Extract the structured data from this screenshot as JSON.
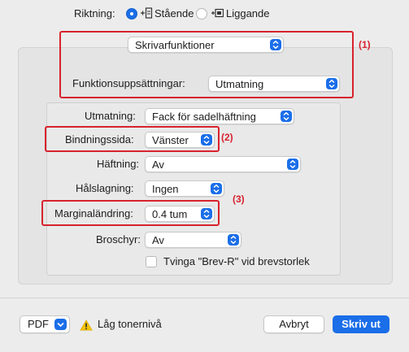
{
  "orientation": {
    "label": "Riktning:",
    "portrait_label": "Stående",
    "landscape_label": "Liggande",
    "selected": "portrait"
  },
  "section_popup": {
    "value": "Skrivarfunktioner"
  },
  "feature_sets": {
    "label": "Funktionsuppsättningar:",
    "value": "Utmatning"
  },
  "options": {
    "output": {
      "label": "Utmatning:",
      "value": "Fack för sadelhäftning"
    },
    "binding": {
      "label": "Bindningssida:",
      "value": "Vänster"
    },
    "staple": {
      "label": "Häftning:",
      "value": "Av"
    },
    "punch": {
      "label": "Hålslagning:",
      "value": "Ingen"
    },
    "margin": {
      "label": "Marginaländring:",
      "value": "0.4 tum"
    },
    "booklet": {
      "label": "Broschyr:",
      "value": "Av"
    },
    "force_letter": {
      "label": "Tvinga \"Brev-R\" vid brevstorlek",
      "checked": false
    }
  },
  "callouts": {
    "one": "(1)",
    "two": "(2)",
    "three": "(3)"
  },
  "footer": {
    "pdf_label": "PDF",
    "warning_text": "Låg tonernivå",
    "cancel_label": "Avbryt",
    "print_label": "Skriv ut"
  },
  "colors": {
    "accent": "#1a6ee8",
    "callout": "#d8222e",
    "warning": "#f5c200"
  }
}
